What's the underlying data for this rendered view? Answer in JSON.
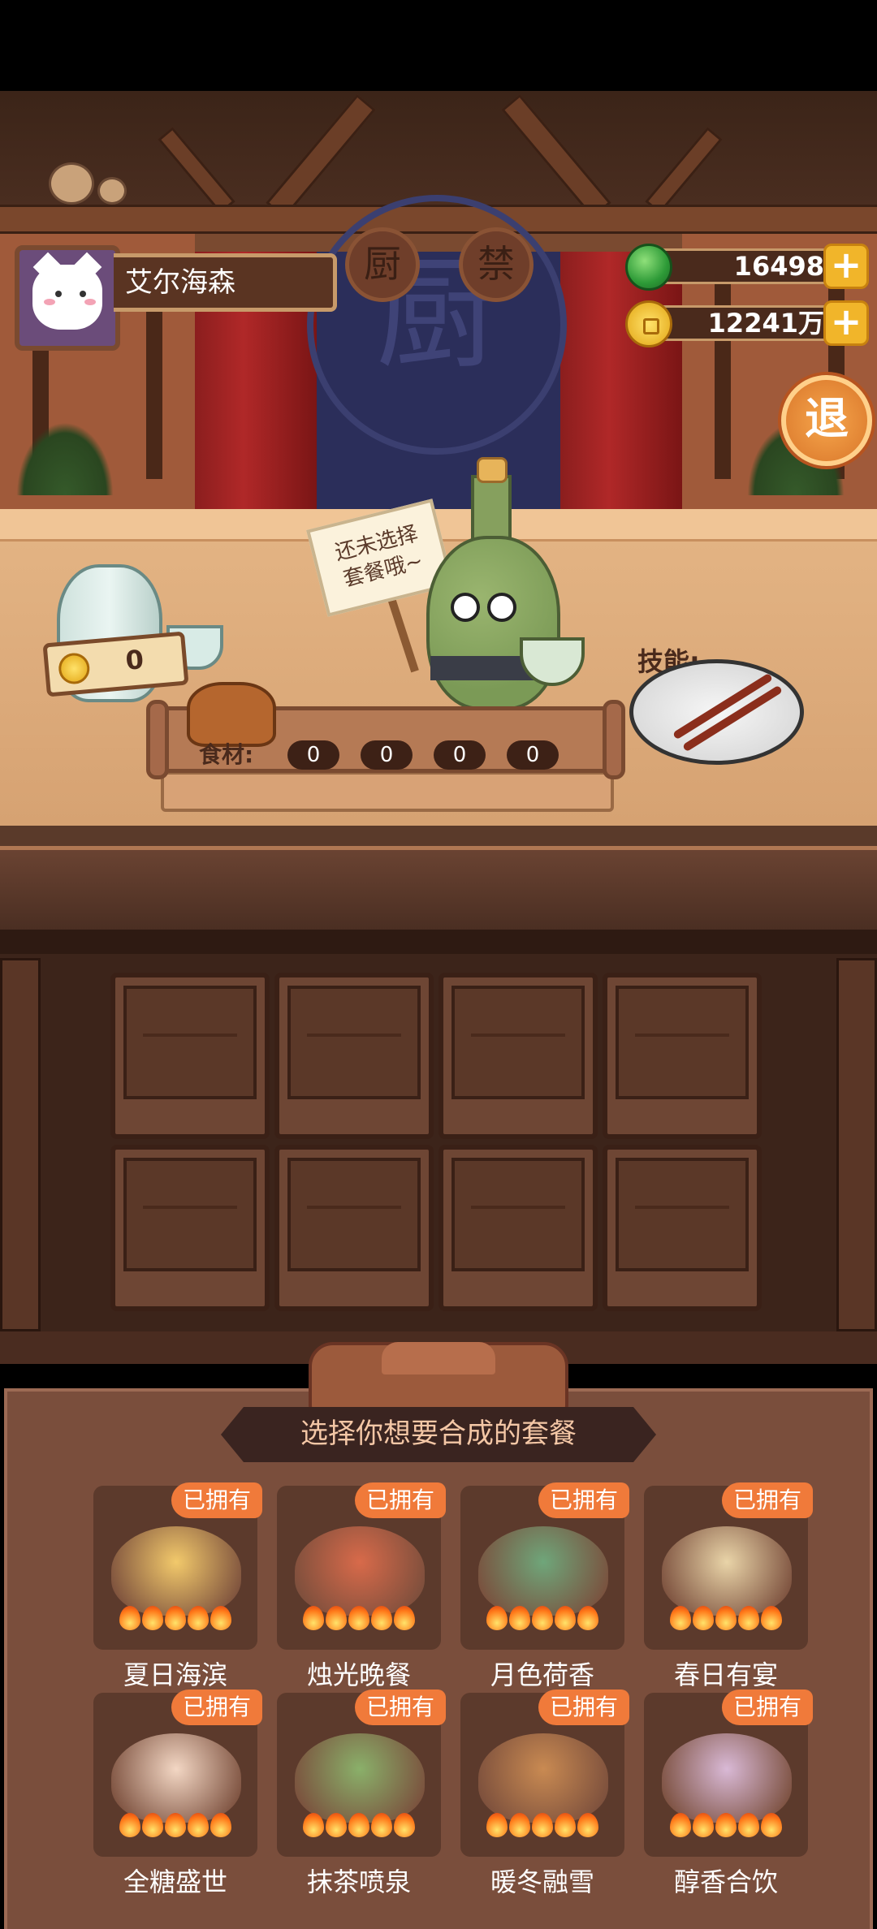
{
  "player": {
    "name": "艾尔海森"
  },
  "currency": {
    "jade": "16498",
    "coins": "12241万"
  },
  "exit_label": "退",
  "stage": {
    "medallions": [
      "厨",
      "禁"
    ],
    "logo": "厨"
  },
  "jar_coins": "0",
  "mascot_sign": {
    "line1": "还未选择",
    "line2": "套餐哦~"
  },
  "skill_label": "技能:",
  "ingredients": {
    "label": "食材:",
    "values": [
      "0",
      "0",
      "0",
      "0"
    ]
  },
  "menu": {
    "title": "选择你想要合成的套餐",
    "owned_badge": "已拥有",
    "items": [
      {
        "name": "夏日海滨",
        "color": "#f2c96b",
        "heat": 5
      },
      {
        "name": "烛光晚餐",
        "color": "#d86a4a",
        "heat": 5
      },
      {
        "name": "月色荷香",
        "color": "#6fa67a",
        "heat": 5
      },
      {
        "name": "春日有宴",
        "color": "#e9d4a8",
        "heat": 5
      },
      {
        "name": "全糖盛世",
        "color": "#f3d7c4",
        "heat": 5
      },
      {
        "name": "抹茶喷泉",
        "color": "#8ab06a",
        "heat": 5
      },
      {
        "name": "暖冬融雪",
        "color": "#c98a52",
        "heat": 5
      },
      {
        "name": "醇香合饮",
        "color": "#d9b9d6",
        "heat": 5
      }
    ]
  }
}
